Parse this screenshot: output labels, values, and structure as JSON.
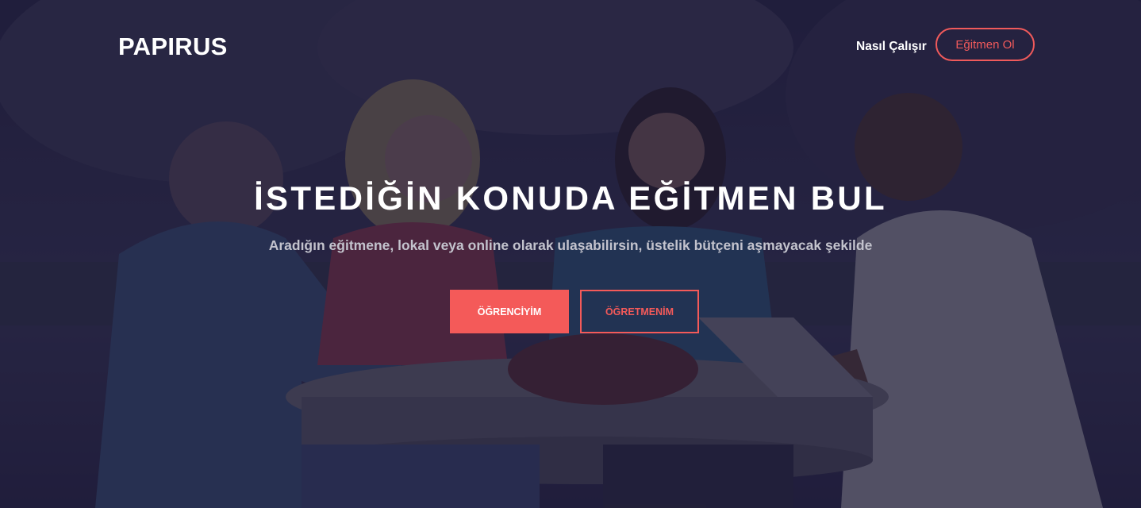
{
  "header": {
    "brand": "PAPIRUS",
    "nav_link": "Nasıl Çalışır",
    "cta_label": "Eğitmen Ol"
  },
  "hero": {
    "title": "İSTEDİĞİN KONUDA EĞİTMEN BUL",
    "subtitle": "Aradığın eğitmene, lokal veya online olarak ulaşabilirsin, üstelik bütçeni aşmayacak şekilde",
    "primary_button": "ÖĞRENCİYİM",
    "secondary_button": "ÖĞRETMENİM"
  },
  "colors": {
    "accent": "#f45a59",
    "overlay": "#181434"
  }
}
